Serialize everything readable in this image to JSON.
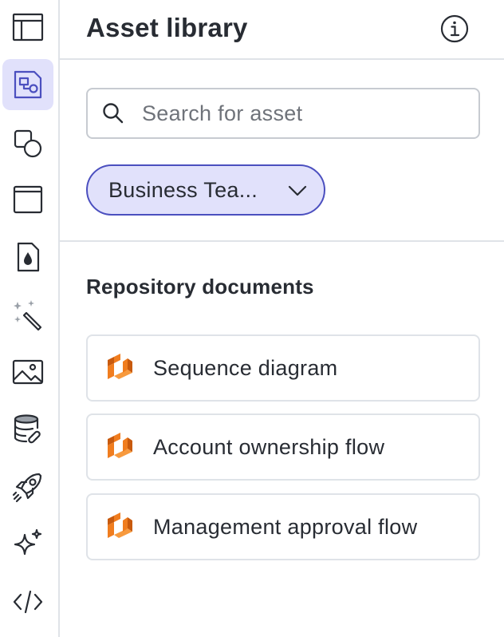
{
  "sidebar": {
    "tools": [
      {
        "name": "layout-icon",
        "active": false
      },
      {
        "name": "asset-library-icon",
        "active": true
      },
      {
        "name": "shapes-icon",
        "active": false
      },
      {
        "name": "frame-icon",
        "active": false
      },
      {
        "name": "theme-icon",
        "active": false
      },
      {
        "name": "magic-wand-icon",
        "active": false
      },
      {
        "name": "image-icon",
        "active": false
      },
      {
        "name": "data-link-icon",
        "active": false
      },
      {
        "name": "rocket-icon",
        "active": false
      },
      {
        "name": "sparkle-icon",
        "active": false
      },
      {
        "name": "code-icon",
        "active": false
      }
    ]
  },
  "panel": {
    "title": "Asset library",
    "info_icon": "info-icon"
  },
  "search": {
    "placeholder": "Search for asset",
    "value": ""
  },
  "filter": {
    "label": "Business Tea...",
    "icon": "chevron-down-icon"
  },
  "section": {
    "title": "Repository documents"
  },
  "documents": [
    {
      "label": "Sequence diagram",
      "icon": "repository-doc-icon"
    },
    {
      "label": "Account ownership flow",
      "icon": "repository-doc-icon"
    },
    {
      "label": "Management approval flow",
      "icon": "repository-doc-icon"
    }
  ],
  "colors": {
    "accent": "#4b4fbf",
    "accent_bg": "#e1e1fb",
    "doc_icon_orange": "#f07d1f",
    "text": "#282c33",
    "border": "#dfe3e8"
  }
}
